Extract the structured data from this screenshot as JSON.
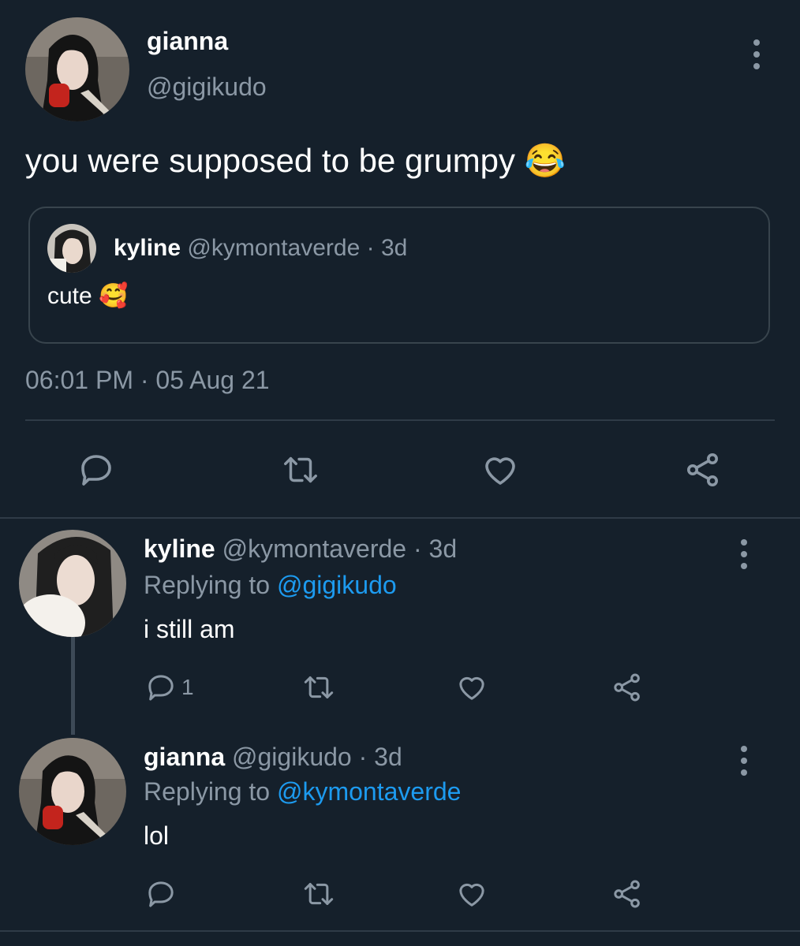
{
  "main_tweet": {
    "author_name": "gianna",
    "author_handle": "@gigikudo",
    "text": "you were supposed to be grumpy",
    "emoji": "😂",
    "timestamp": "06:01 PM · 05 Aug 21",
    "quoted": {
      "author_name": "kyline",
      "author_handle": "@kymontaverde",
      "age": "· 3d",
      "text": "cute",
      "emoji": "🥰"
    }
  },
  "replies": [
    {
      "author_name": "kyline",
      "author_handle": "@kymontaverde",
      "age": "· 3d",
      "replying_label": "Replying to",
      "replying_to": "@gigikudo",
      "text": "i still am",
      "reply_count": "1"
    },
    {
      "author_name": "gianna",
      "author_handle": "@gigikudo",
      "age": "· 3d",
      "replying_label": "Replying to",
      "replying_to": "@kymontaverde",
      "text": "lol"
    }
  ],
  "icons": {
    "more": "more-vertical-icon",
    "reply": "comment-icon",
    "retweet": "retweet-icon",
    "like": "heart-icon",
    "share": "share-icon"
  },
  "colors": {
    "background": "#15202b",
    "text": "#ffffff",
    "muted": "#8b98a5",
    "link": "#1d9bf0",
    "border": "#38444d"
  }
}
